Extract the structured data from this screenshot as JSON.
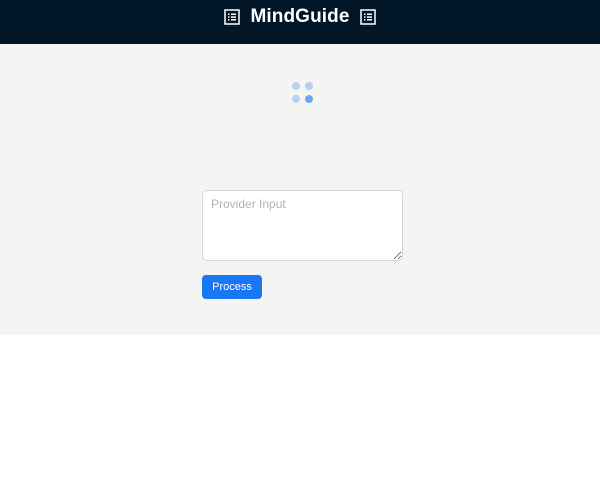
{
  "header": {
    "title": "MindGuide",
    "left_icon": "document-list-icon",
    "right_icon": "document-list-icon",
    "background": "#011627"
  },
  "main": {
    "background": "#f4f4f2",
    "loading_indicator": "spinner-dots-icon",
    "input": {
      "placeholder": "Provider Input",
      "value": ""
    },
    "process_button_label": "Process",
    "accent": "#1977f3"
  }
}
